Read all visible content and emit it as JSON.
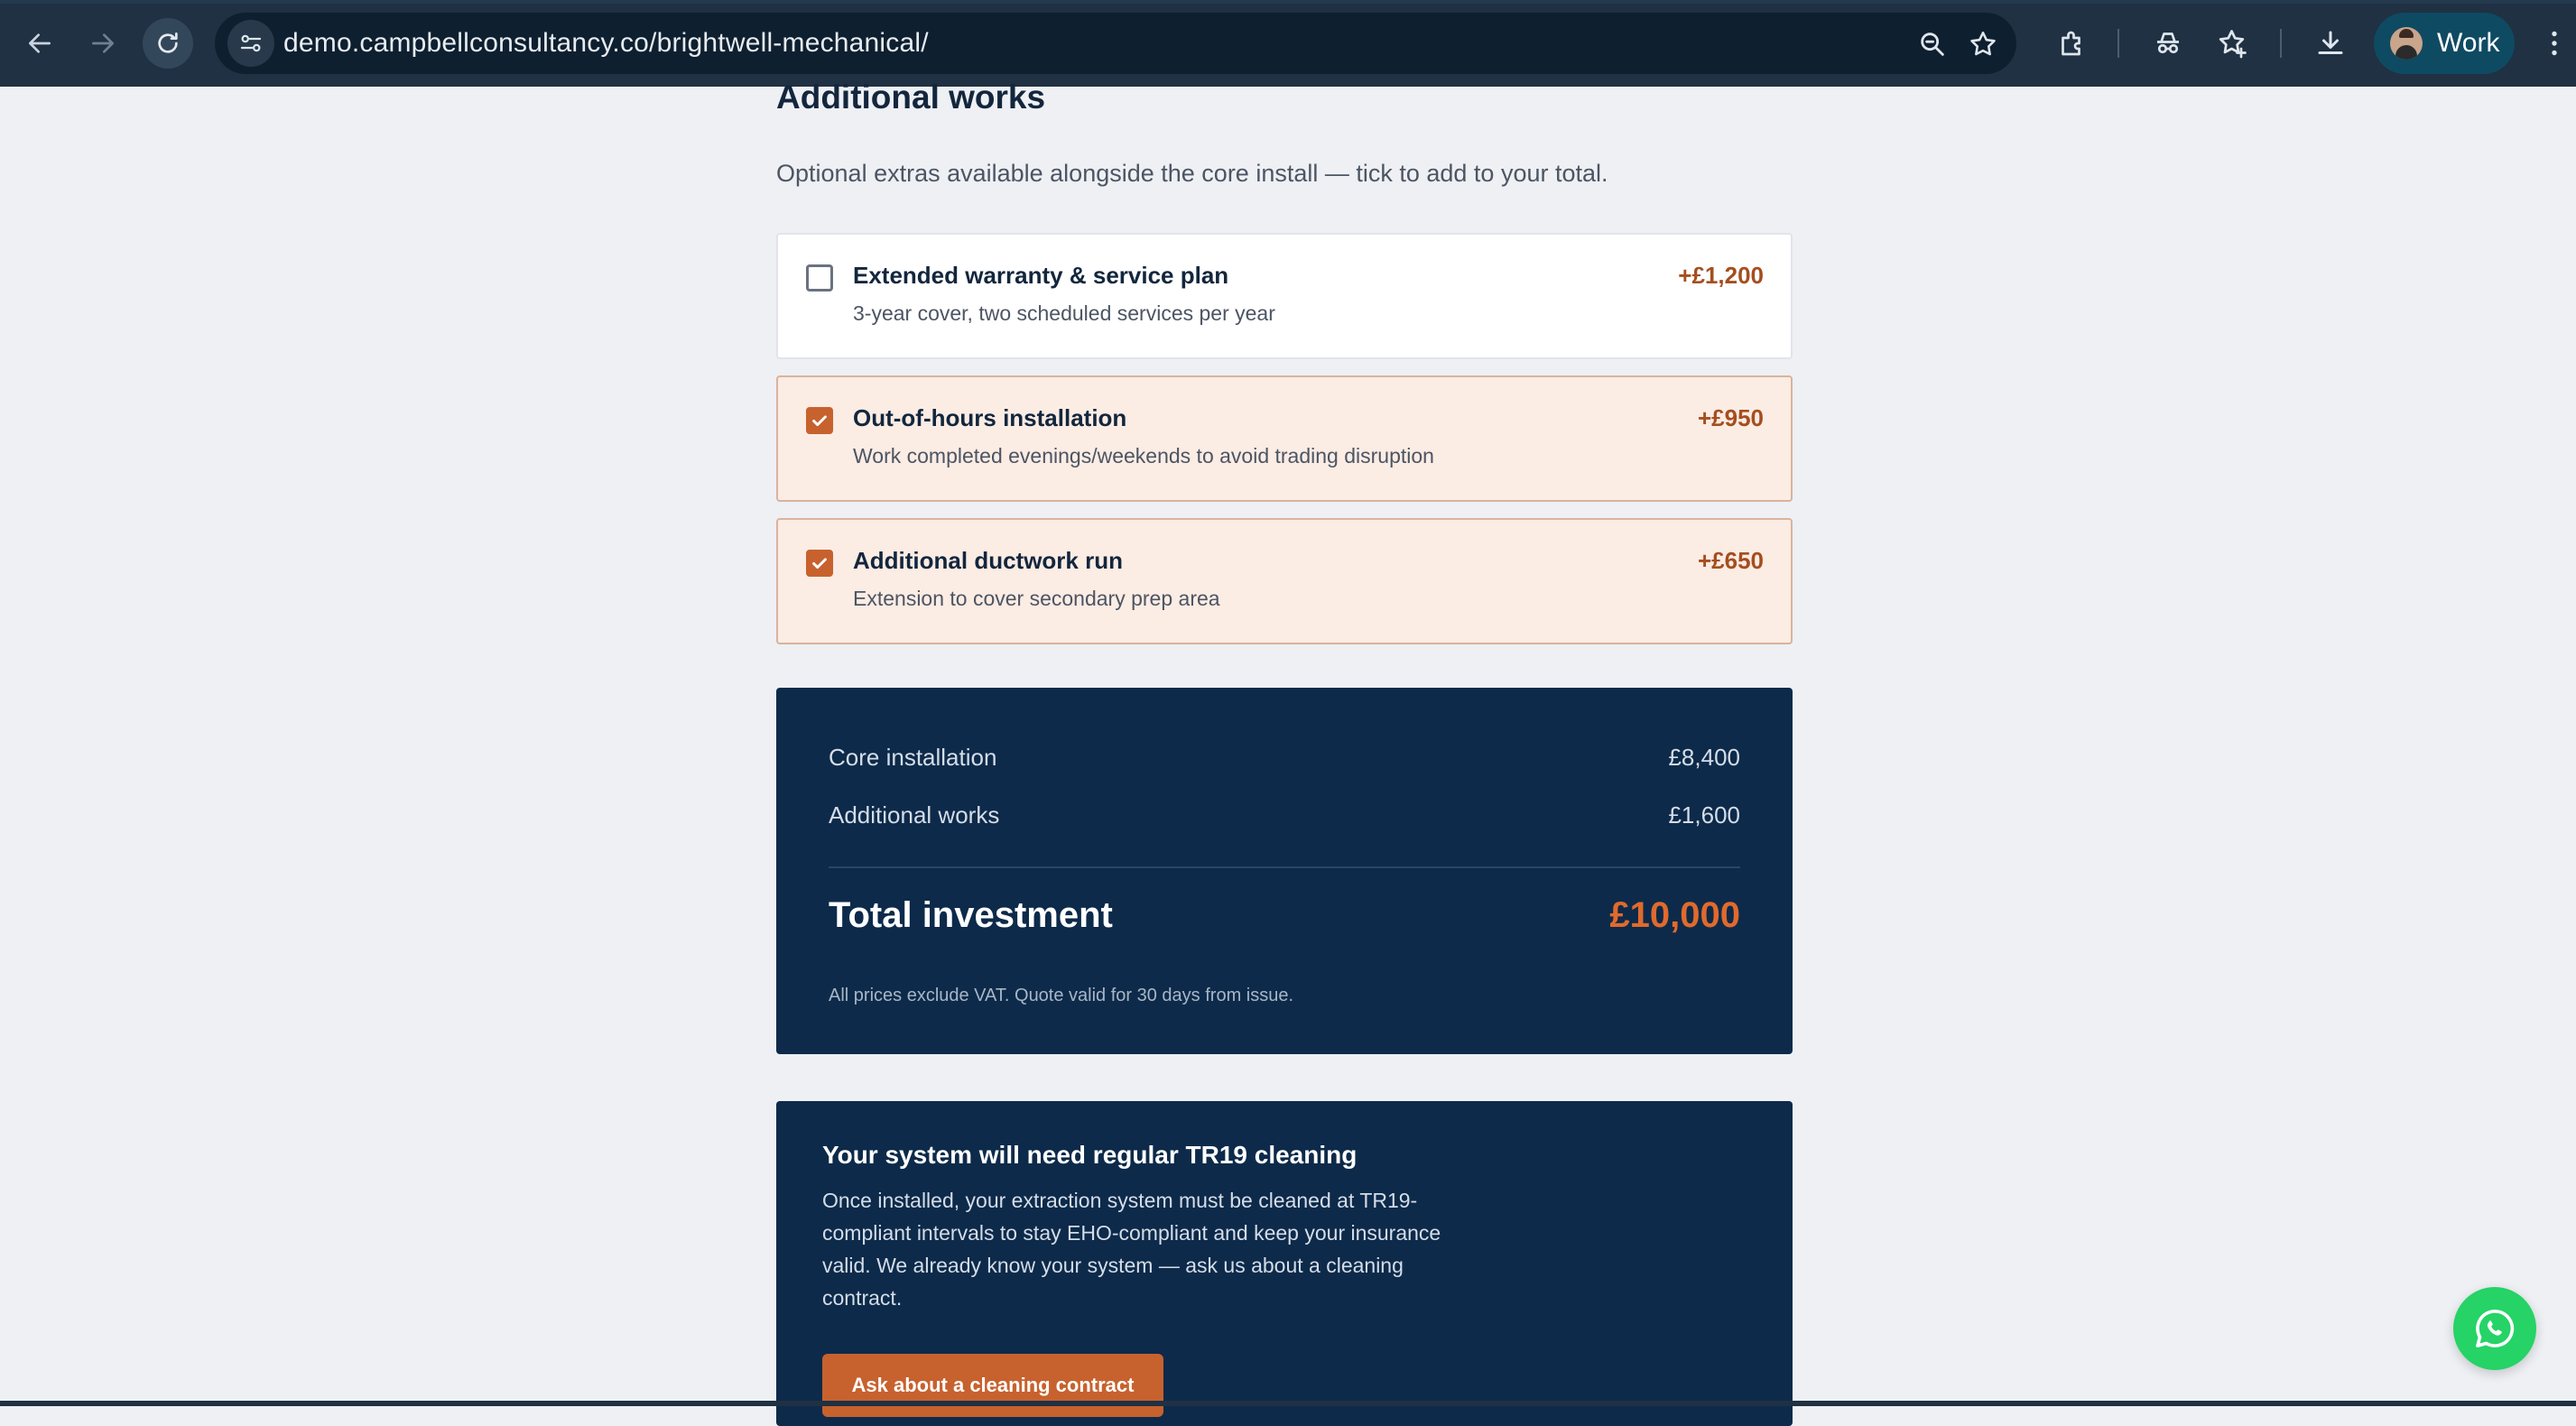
{
  "browser": {
    "url": "demo.campbellconsultancy.co/brightwell-mechanical/",
    "profile_label": "Work"
  },
  "additional_works": {
    "title": "Additional works",
    "subtitle": "Optional extras available alongside the core install — tick to add to your total.",
    "options": [
      {
        "title": "Extended warranty & service plan",
        "description": "3-year cover, two scheduled services per year",
        "price": "+£1,200",
        "checked": false
      },
      {
        "title": "Out-of-hours installation",
        "description": "Work completed evenings/weekends to avoid trading disruption",
        "price": "+£950",
        "checked": true
      },
      {
        "title": "Additional ductwork run",
        "description": "Extension to cover secondary prep area",
        "price": "+£650",
        "checked": true
      }
    ]
  },
  "summary": {
    "core_label": "Core installation",
    "core_value": "£8,400",
    "additional_label": "Additional works",
    "additional_value": "£1,600",
    "total_label": "Total investment",
    "total_value": "£10,000",
    "note": "All prices exclude VAT. Quote valid for 30 days from issue."
  },
  "promo": {
    "title": "Your system will need regular TR19 cleaning",
    "text": "Once installed, your extraction system must be cleaned at TR19-compliant intervals to stay EHO-compliant and keep your insurance valid. We already know your system — ask us about a cleaning contract.",
    "button_label": "Ask about a cleaning contract"
  },
  "colors": {
    "accent": "#c7622e",
    "navy": "#0d2a4a",
    "chat": "#25d366"
  }
}
